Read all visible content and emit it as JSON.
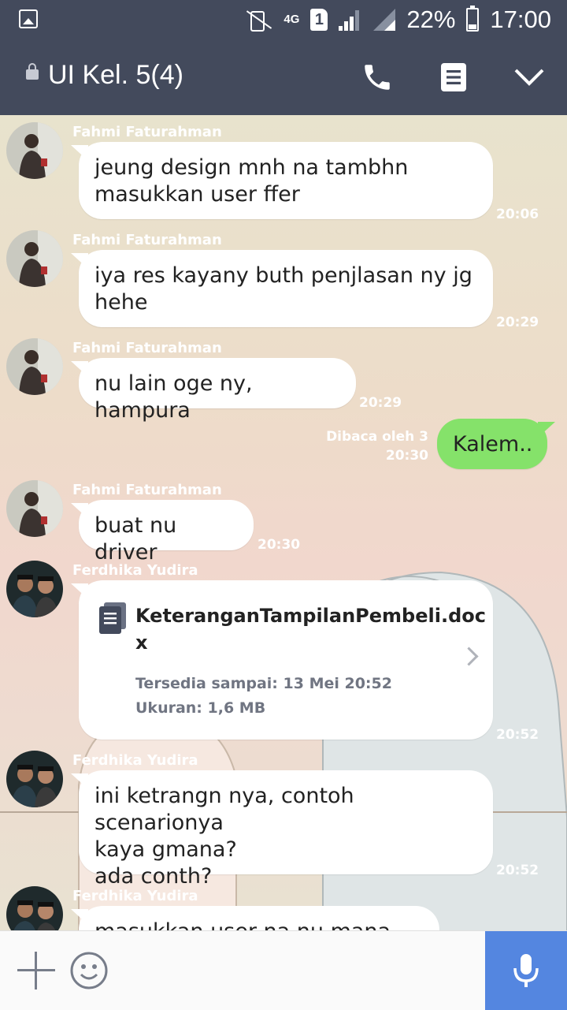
{
  "status_bar": {
    "network": "4G",
    "sim": "1",
    "battery": "22%",
    "time": "17:00"
  },
  "header": {
    "title": "UI Kel. 5(4)"
  },
  "messages": [
    {
      "sender": "Fahmi Faturahman",
      "lines": [
        "jeung design mnh na tambhn",
        "masukkan user ffer"
      ],
      "time": "20:06"
    },
    {
      "sender": "Fahmi Faturahman",
      "lines": [
        "iya res kayany buth penjlasan ny jg",
        "hehe"
      ],
      "time": "20:29"
    },
    {
      "sender": "Fahmi Faturahman",
      "lines": [
        "nu lain oge ny, hampura"
      ],
      "time": "20:29"
    },
    {
      "mine": true,
      "text": "Kalem..",
      "read": "Dibaca oleh 3",
      "time": "20:30"
    },
    {
      "sender": "Fahmi Faturahman",
      "lines": [
        "buat nu driver"
      ],
      "time": "20:30"
    },
    {
      "sender": "Ferdhika Yudira",
      "file": {
        "name_line1": "KeteranganTampilanPembeli.doc",
        "name_line2": "x",
        "available": "Tersedia sampai: 13 Mei 20:52",
        "size": "Ukuran: 1,6 MB"
      },
      "time": "20:52"
    },
    {
      "sender": "Ferdhika Yudira",
      "lines": [
        "ini ketrangn nya, contoh scenarionya",
        "kaya gmana?",
        "ada conth?"
      ],
      "time": "20:52"
    },
    {
      "sender": "Ferdhika Yudira",
      "lines": [
        "masukkan user na nu mana mi?"
      ]
    }
  ],
  "colors": {
    "header_bg": "#434a5c",
    "my_bubble": "#85e26a",
    "their_bubble": "#ffffff",
    "mic_button": "#5486e0"
  },
  "icons": [
    "call-icon",
    "note-icon",
    "chevron-down-icon",
    "plus-icon",
    "emoji-icon",
    "mic-icon",
    "document-icon",
    "lock-icon"
  ]
}
